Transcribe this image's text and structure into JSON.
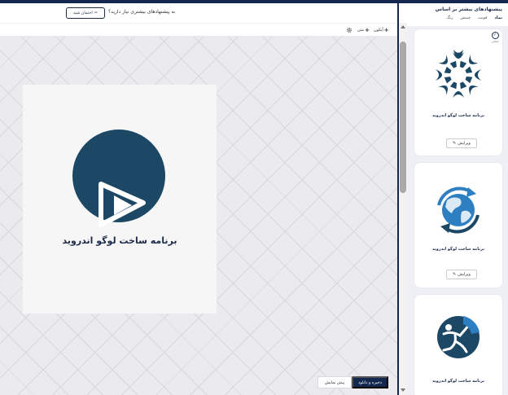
{
  "colors": {
    "brand": "#14274e",
    "logo": "#1c4866",
    "accent": "#2d7fc1"
  },
  "topbar": {
    "prompt": "به پیشنهادهای بیشتری نیاز دارید؟",
    "verify_label": "احتمان شید",
    "verify_icon": "magic-wand-icon"
  },
  "toolbar": {
    "gear_icon": "gear-icon",
    "items": [
      {
        "label": "متن",
        "icon": "plus-icon"
      },
      {
        "label": "آیکون",
        "icon": "plus-icon"
      }
    ]
  },
  "canvas": {
    "logo_text": "برنامه ساخت لوگو اندروید",
    "logo_icon": "play-with-bubbles-icon"
  },
  "actions": {
    "save_label": "ذخیره و دانلود",
    "preview_label": "پیش نمایش"
  },
  "panel": {
    "title": "پیشنهادهای بیشتر بر اساس",
    "tabs": [
      {
        "label": "نماد",
        "active": true
      },
      {
        "label": "فونت",
        "active": false
      },
      {
        "label": "چینش",
        "active": false
      },
      {
        "label": "رنگ",
        "active": false
      }
    ],
    "badge_label": "انتخابی",
    "cards": [
      {
        "name": "برنامه ساخت لوگو اندروید",
        "edit_label": "ویرایش",
        "icon": "star-burst-icon"
      },
      {
        "name": "برنامه ساخت لوگو اندروید",
        "edit_label": "ویرایش",
        "icon": "globe-arrows-icon"
      },
      {
        "name": "برنامه ساخت لوگو اندروید",
        "edit_label": "ویرایش",
        "icon": "runner-icon"
      }
    ]
  }
}
